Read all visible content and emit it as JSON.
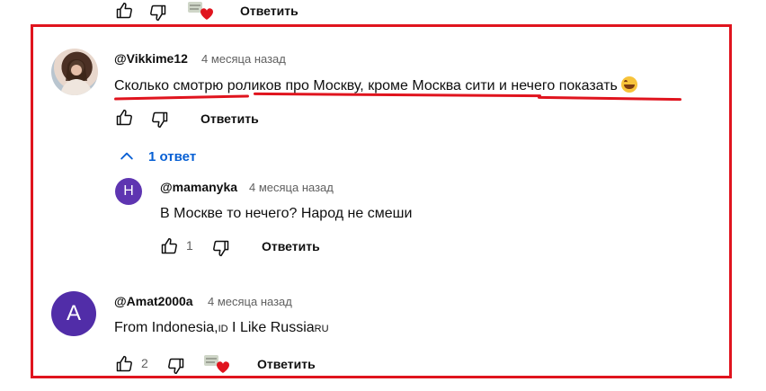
{
  "top_actions": {
    "reply_label": "Ответить"
  },
  "comment1": {
    "author": "@Vikkime12",
    "time": "4 месяца назад",
    "text": "Сколько смотрю роликов про Москву, кроме Москва сити и нечего показать",
    "reply_label": "Ответить",
    "replies_toggle": "1 ответ",
    "reply": {
      "avatar_letter": "Н",
      "author": "@mamanyka",
      "time": "4 месяца назад",
      "text": "В Москве то нечего? Народ не смеши",
      "likes": "1",
      "reply_label": "Ответить"
    }
  },
  "comment2": {
    "avatar_letter": "A",
    "author": "@Amat2000a",
    "time": "4 месяца назад",
    "text_main": "From Indonesia,",
    "flag1": "ID",
    "text_mid": " I Like Russia",
    "flag2": "RU",
    "likes": "2",
    "reply_label": "Ответить"
  },
  "colors": {
    "highlight": "#e0141e",
    "link": "#065fd4",
    "avatar_purple": "#5e35b1",
    "avatar_violet": "#512da8"
  }
}
